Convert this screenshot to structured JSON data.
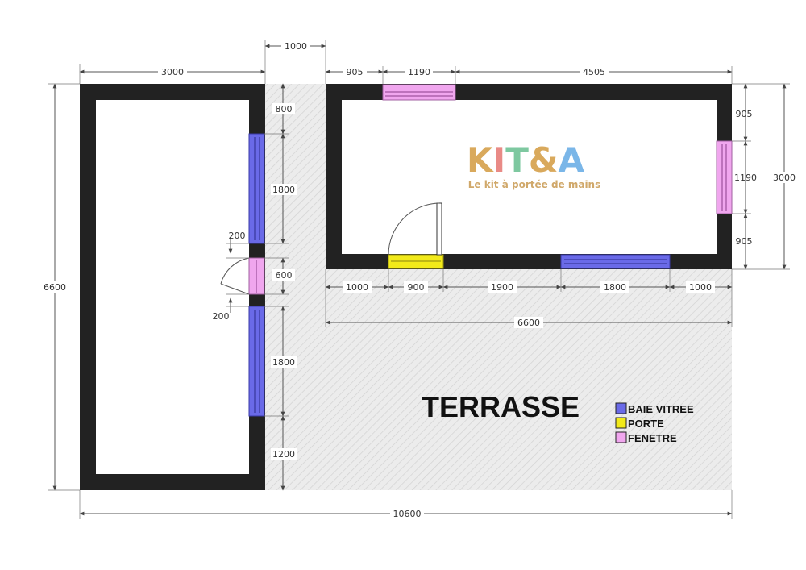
{
  "plan": {
    "terrace_label": "TERRASSE",
    "legend": [
      {
        "label": "BAIE VITREE",
        "color": "#6a6ae8"
      },
      {
        "label": "PORTE",
        "color": "#f2ea1a"
      },
      {
        "label": "FENETRE",
        "color": "#f0a6ee"
      }
    ],
    "dimensions": {
      "top_left_width": "3000",
      "top_passage": "1000",
      "top_seg1": "905",
      "top_window": "1190",
      "top_seg3": "4505",
      "left_height": "6600",
      "left_wall_top": "800",
      "left_wall_bay1": "1800",
      "left_wall_door_offset_top": "200",
      "left_wall_door": "600",
      "left_wall_door_offset_bottom": "200",
      "left_wall_bay2": "1800",
      "left_wall_bottom": "1200",
      "right_seg1": "905",
      "right_window": "1190",
      "right_seg3": "905",
      "right_height": "3000",
      "front_seg1": "1000",
      "front_door": "900",
      "front_seg3": "1900",
      "front_bay": "1800",
      "front_seg5": "1000",
      "front_total": "6600",
      "overall_width": "10600"
    }
  },
  "logo": {
    "letters": [
      "K",
      "I",
      "T",
      "&",
      "A"
    ],
    "tagline": "Le kit à portée de mains"
  }
}
